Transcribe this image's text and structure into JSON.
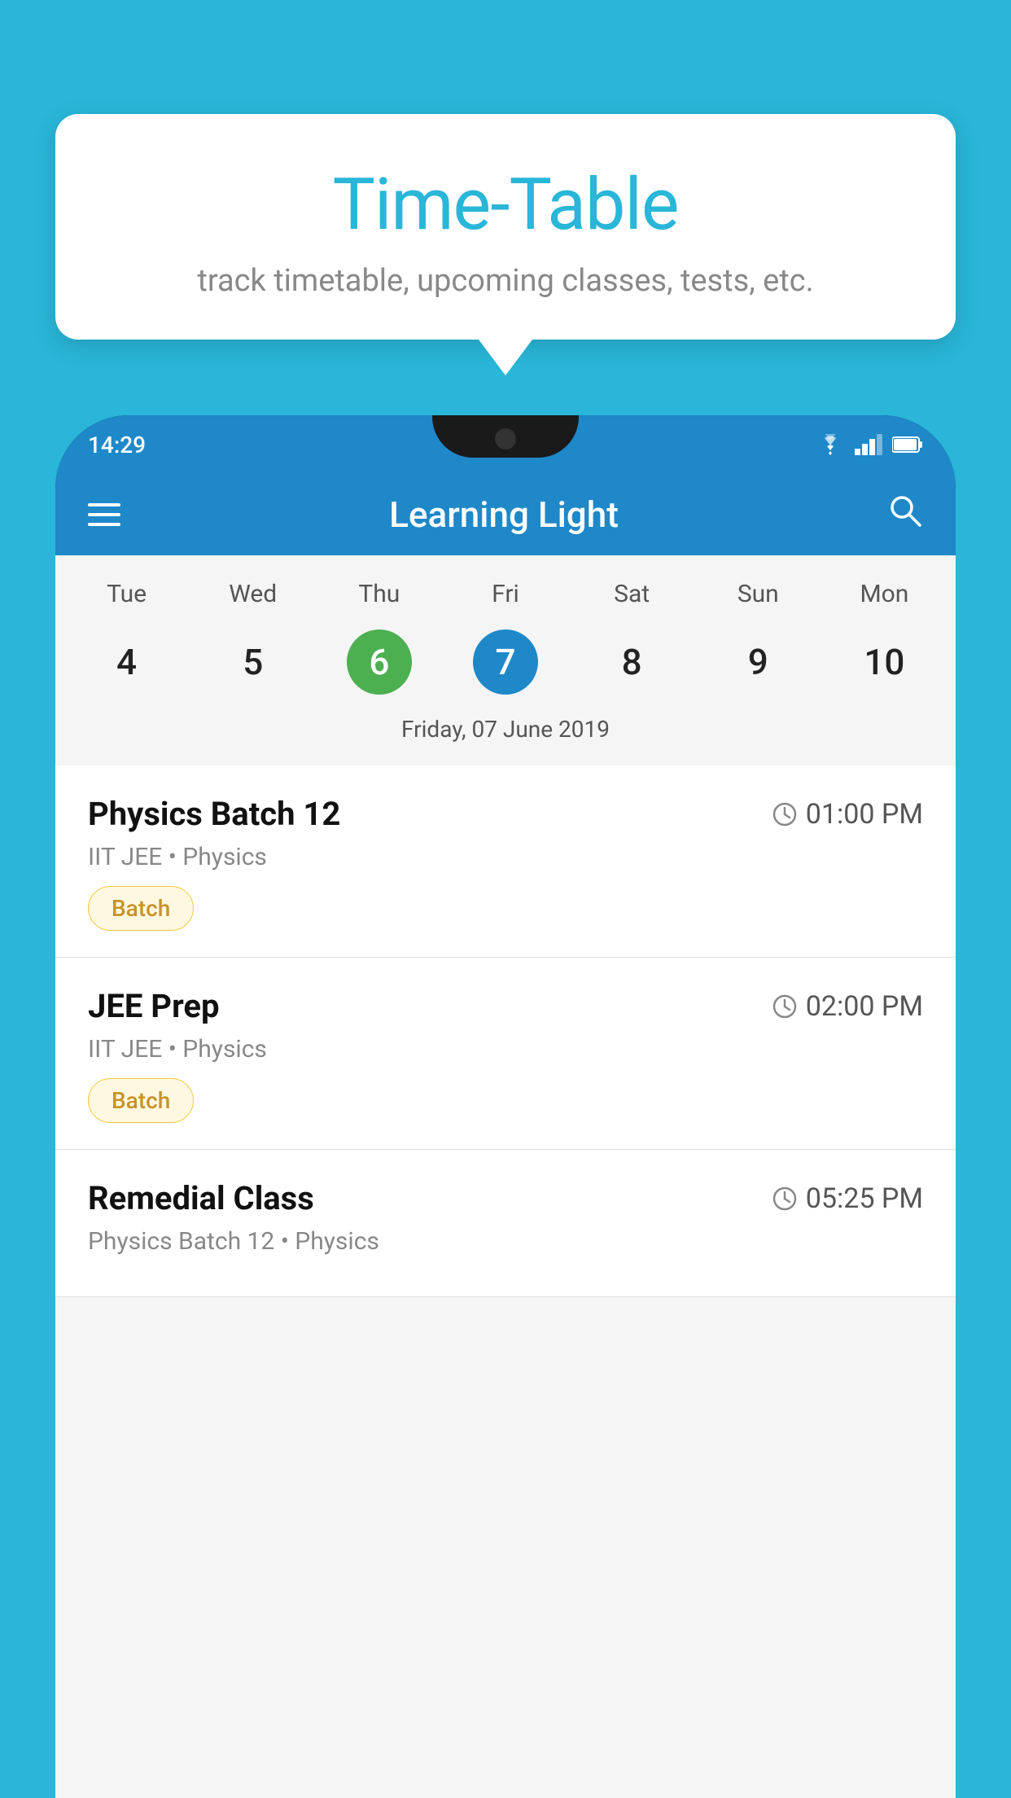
{
  "background_color": "#29b6d8",
  "tooltip": {
    "title": "Time-Table",
    "subtitle": "track timetable, upcoming classes, tests, etc."
  },
  "phone": {
    "status_bar": {
      "time": "14:29",
      "icons": [
        "wifi",
        "signal",
        "battery"
      ]
    },
    "toolbar": {
      "title": "Learning Light"
    },
    "calendar": {
      "days": [
        "Tue",
        "Wed",
        "Thu",
        "Fri",
        "Sat",
        "Sun",
        "Mon"
      ],
      "dates": [
        {
          "number": "4",
          "state": "normal"
        },
        {
          "number": "5",
          "state": "normal"
        },
        {
          "number": "6",
          "state": "today"
        },
        {
          "number": "7",
          "state": "selected"
        },
        {
          "number": "8",
          "state": "normal"
        },
        {
          "number": "9",
          "state": "normal"
        },
        {
          "number": "10",
          "state": "normal"
        }
      ],
      "selected_date_label": "Friday, 07 June 2019"
    },
    "schedule": [
      {
        "title": "Physics Batch 12",
        "time": "01:00 PM",
        "subtitle": "IIT JEE • Physics",
        "badge": "Batch"
      },
      {
        "title": "JEE Prep",
        "time": "02:00 PM",
        "subtitle": "IIT JEE • Physics",
        "badge": "Batch"
      },
      {
        "title": "Remedial Class",
        "time": "05:25 PM",
        "subtitle": "Physics Batch 12 • Physics",
        "badge": null
      }
    ]
  }
}
